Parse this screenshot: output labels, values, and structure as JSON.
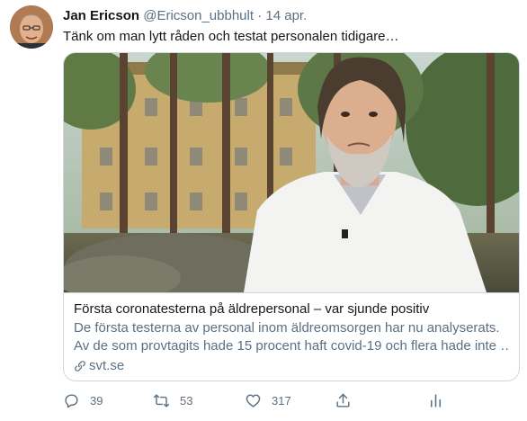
{
  "tweet": {
    "author_name": "Jan Ericson",
    "handle": "@Ericson_ubbhult",
    "separator": "·",
    "date": "14 apr.",
    "text": "Tänk om man lytt råden och testat personalen tidigare…"
  },
  "card": {
    "title": "Första coronatesterna på äldrepersonal – var sjunde positiv",
    "description_line1": "De första testerna av personal inom äldreomsorgen har nu analyserats.",
    "description_line2": "Av de som provtagits hade 15 procent haft covid-19 och flera hade inte …",
    "domain": "svt.se"
  },
  "actions": {
    "reply_count": "39",
    "retweet_count": "53",
    "like_count": "317"
  },
  "icons": {
    "reply": "reply-icon",
    "retweet": "retweet-icon",
    "like": "heart-icon",
    "share": "share-icon",
    "analytics": "analytics-icon",
    "link": "link-icon"
  },
  "colors": {
    "text_primary": "#14171a",
    "text_secondary": "#5b7083",
    "border": "#ccd6dd"
  }
}
